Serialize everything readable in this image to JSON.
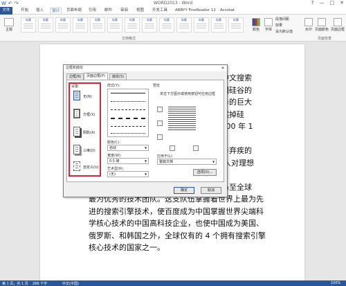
{
  "window": {
    "title": "WORD2013 - Word",
    "qa_icons": [
      "W",
      "↶",
      "↷"
    ],
    "controls": [
      "?",
      "—",
      "□",
      "✕"
    ]
  },
  "ribbon_tabs": [
    "文件",
    "开始",
    "插入",
    "设计",
    "页面布局",
    "引用",
    "邮件",
    "审阅",
    "视图",
    "开发工具",
    "ABBYY FineReader 12",
    "Acrobat"
  ],
  "ribbon": {
    "theme_label": "主题",
    "style_title": "标题",
    "group_label": "文档格式",
    "colors_label": "颜色",
    "fonts_label": "字体",
    "options": [
      "段落间距",
      "效果",
      "设为默认值"
    ],
    "watermark_label": "水印",
    "page_color_label": "页面颜色",
    "page_border_label": "页面边框",
    "page_bg_label": "页面背景"
  },
  "document": {
    "lines": [
      "大的中文搜索",
      "在美国硅谷的",
      "务服务的巨大",
      "也毅然掉硅",
      "于 2000 年 1",
      "",
      "闻人辛弃疾的",
      "了'闻人对理想",
      "",
      "中国乃至全球",
      "最为优秀的技术团队。这支队伍掌握着世界上最为先",
      "进的搜索引擎技术，使百度成为中国掌握世界尖端科",
      "学核心技术的中国高科技企业，也使中国成为美国、",
      "俄罗斯、和韩国之外，全球仅有的 4 个拥有搜索引擎",
      "核心技术的国家之一。"
    ]
  },
  "dialog": {
    "title": "边框和底纹",
    "close": "✕",
    "tabs": [
      "边框(B)",
      "页面边框(P)",
      "底纹(S)"
    ],
    "settings_label": "设置:",
    "settings": [
      "无(N)",
      "方框(X)",
      "阴影(A)",
      "三维(D)",
      "自定义(U)"
    ],
    "style_label": "样式(Y):",
    "color_label": "颜色(C):",
    "color_value": "自动",
    "width_label": "宽度(W):",
    "width_value": "0.5 磅",
    "art_label": "艺术型(R):",
    "art_value": "(无)",
    "preview_label": "预览",
    "preview_hint": "单击下方图示或使用按钮可应用边框",
    "apply_label": "应用于(L):",
    "apply_value": "整篇文档",
    "options_button": "选项(O)...",
    "ok_button": "确定",
    "cancel_button": "取消"
  },
  "status": {
    "page": "第 1 页，共 1 页",
    "words": "266 个字",
    "lang": "中文(中国)",
    "zoom": "100%"
  },
  "colors": {
    "accent": "#2b579a",
    "highlight": "#d0283a"
  }
}
